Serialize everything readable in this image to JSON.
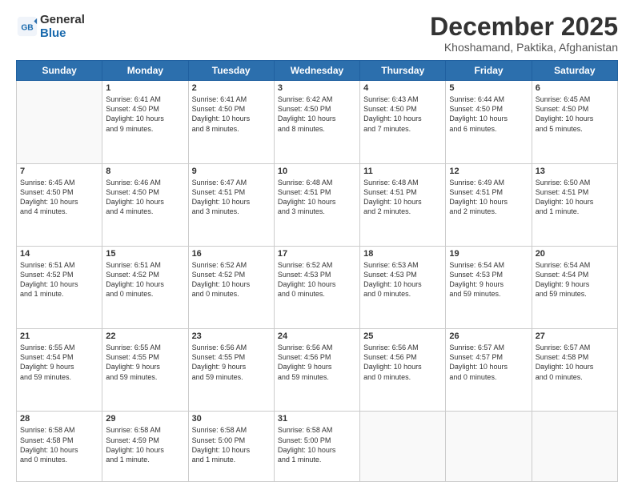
{
  "logo": {
    "line1": "General",
    "line2": "Blue"
  },
  "title": "December 2025",
  "location": "Khoshamand, Paktika, Afghanistan",
  "days_header": [
    "Sunday",
    "Monday",
    "Tuesday",
    "Wednesday",
    "Thursday",
    "Friday",
    "Saturday"
  ],
  "weeks": [
    [
      {
        "day": "",
        "info": ""
      },
      {
        "day": "1",
        "info": "Sunrise: 6:41 AM\nSunset: 4:50 PM\nDaylight: 10 hours\nand 9 minutes."
      },
      {
        "day": "2",
        "info": "Sunrise: 6:41 AM\nSunset: 4:50 PM\nDaylight: 10 hours\nand 8 minutes."
      },
      {
        "day": "3",
        "info": "Sunrise: 6:42 AM\nSunset: 4:50 PM\nDaylight: 10 hours\nand 8 minutes."
      },
      {
        "day": "4",
        "info": "Sunrise: 6:43 AM\nSunset: 4:50 PM\nDaylight: 10 hours\nand 7 minutes."
      },
      {
        "day": "5",
        "info": "Sunrise: 6:44 AM\nSunset: 4:50 PM\nDaylight: 10 hours\nand 6 minutes."
      },
      {
        "day": "6",
        "info": "Sunrise: 6:45 AM\nSunset: 4:50 PM\nDaylight: 10 hours\nand 5 minutes."
      }
    ],
    [
      {
        "day": "7",
        "info": "Sunrise: 6:45 AM\nSunset: 4:50 PM\nDaylight: 10 hours\nand 4 minutes."
      },
      {
        "day": "8",
        "info": "Sunrise: 6:46 AM\nSunset: 4:50 PM\nDaylight: 10 hours\nand 4 minutes."
      },
      {
        "day": "9",
        "info": "Sunrise: 6:47 AM\nSunset: 4:51 PM\nDaylight: 10 hours\nand 3 minutes."
      },
      {
        "day": "10",
        "info": "Sunrise: 6:48 AM\nSunset: 4:51 PM\nDaylight: 10 hours\nand 3 minutes."
      },
      {
        "day": "11",
        "info": "Sunrise: 6:48 AM\nSunset: 4:51 PM\nDaylight: 10 hours\nand 2 minutes."
      },
      {
        "day": "12",
        "info": "Sunrise: 6:49 AM\nSunset: 4:51 PM\nDaylight: 10 hours\nand 2 minutes."
      },
      {
        "day": "13",
        "info": "Sunrise: 6:50 AM\nSunset: 4:51 PM\nDaylight: 10 hours\nand 1 minute."
      }
    ],
    [
      {
        "day": "14",
        "info": "Sunrise: 6:51 AM\nSunset: 4:52 PM\nDaylight: 10 hours\nand 1 minute."
      },
      {
        "day": "15",
        "info": "Sunrise: 6:51 AM\nSunset: 4:52 PM\nDaylight: 10 hours\nand 0 minutes."
      },
      {
        "day": "16",
        "info": "Sunrise: 6:52 AM\nSunset: 4:52 PM\nDaylight: 10 hours\nand 0 minutes."
      },
      {
        "day": "17",
        "info": "Sunrise: 6:52 AM\nSunset: 4:53 PM\nDaylight: 10 hours\nand 0 minutes."
      },
      {
        "day": "18",
        "info": "Sunrise: 6:53 AM\nSunset: 4:53 PM\nDaylight: 10 hours\nand 0 minutes."
      },
      {
        "day": "19",
        "info": "Sunrise: 6:54 AM\nSunset: 4:53 PM\nDaylight: 9 hours\nand 59 minutes."
      },
      {
        "day": "20",
        "info": "Sunrise: 6:54 AM\nSunset: 4:54 PM\nDaylight: 9 hours\nand 59 minutes."
      }
    ],
    [
      {
        "day": "21",
        "info": "Sunrise: 6:55 AM\nSunset: 4:54 PM\nDaylight: 9 hours\nand 59 minutes."
      },
      {
        "day": "22",
        "info": "Sunrise: 6:55 AM\nSunset: 4:55 PM\nDaylight: 9 hours\nand 59 minutes."
      },
      {
        "day": "23",
        "info": "Sunrise: 6:56 AM\nSunset: 4:55 PM\nDaylight: 9 hours\nand 59 minutes."
      },
      {
        "day": "24",
        "info": "Sunrise: 6:56 AM\nSunset: 4:56 PM\nDaylight: 9 hours\nand 59 minutes."
      },
      {
        "day": "25",
        "info": "Sunrise: 6:56 AM\nSunset: 4:56 PM\nDaylight: 10 hours\nand 0 minutes."
      },
      {
        "day": "26",
        "info": "Sunrise: 6:57 AM\nSunset: 4:57 PM\nDaylight: 10 hours\nand 0 minutes."
      },
      {
        "day": "27",
        "info": "Sunrise: 6:57 AM\nSunset: 4:58 PM\nDaylight: 10 hours\nand 0 minutes."
      }
    ],
    [
      {
        "day": "28",
        "info": "Sunrise: 6:58 AM\nSunset: 4:58 PM\nDaylight: 10 hours\nand 0 minutes."
      },
      {
        "day": "29",
        "info": "Sunrise: 6:58 AM\nSunset: 4:59 PM\nDaylight: 10 hours\nand 1 minute."
      },
      {
        "day": "30",
        "info": "Sunrise: 6:58 AM\nSunset: 5:00 PM\nDaylight: 10 hours\nand 1 minute."
      },
      {
        "day": "31",
        "info": "Sunrise: 6:58 AM\nSunset: 5:00 PM\nDaylight: 10 hours\nand 1 minute."
      },
      {
        "day": "",
        "info": ""
      },
      {
        "day": "",
        "info": ""
      },
      {
        "day": "",
        "info": ""
      }
    ]
  ]
}
